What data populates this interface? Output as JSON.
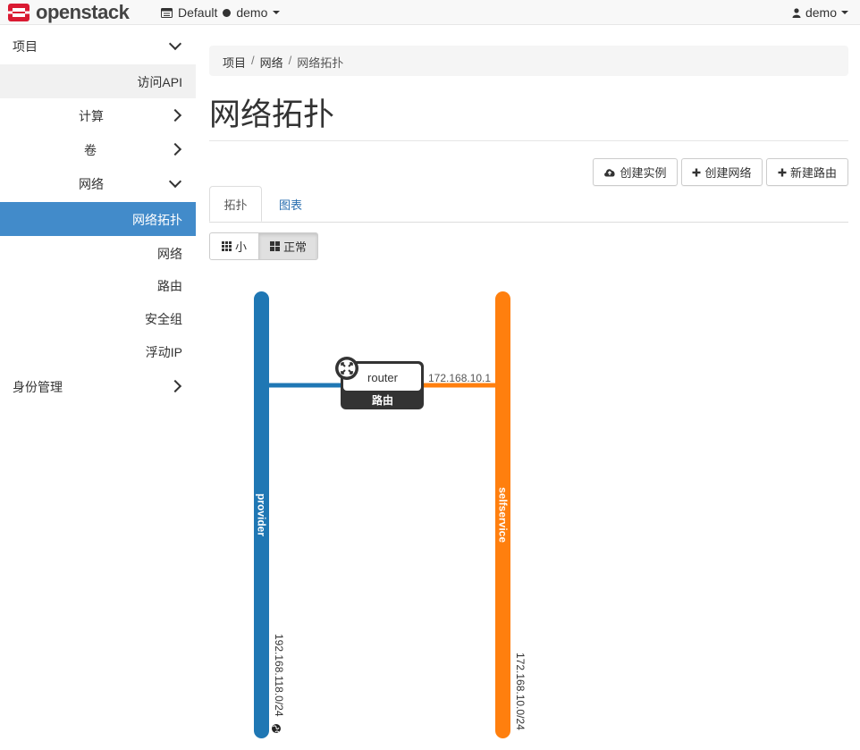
{
  "navbar": {
    "brand": "openstack",
    "domain": "Default",
    "project": "demo",
    "user": "demo"
  },
  "sidebar": {
    "project": "项目",
    "api_access": "访问API",
    "compute": "计算",
    "volumes": "卷",
    "network": "网络",
    "network_topology": "网络拓扑",
    "networks": "网络",
    "routers": "路由",
    "security_groups": "安全组",
    "floating_ips": "浮动IP",
    "identity": "身份管理"
  },
  "breadcrumb": [
    "项目",
    "网络",
    "网络拓扑"
  ],
  "page_title": "网络拓扑",
  "actions": {
    "launch_instance": "创建实例",
    "create_network": "创建网络",
    "create_router": "新建路由"
  },
  "tabs": {
    "topology": "拓扑",
    "graph": "图表"
  },
  "size_toggle": {
    "small": "小",
    "normal": "正常"
  },
  "topology": {
    "networks": [
      {
        "name": "provider",
        "cidr": "192.168.118.0/24",
        "color": "#1f77b4",
        "external": true
      },
      {
        "name": "selfservice",
        "cidr": "172.168.10.0/24",
        "color": "#ff7f0e",
        "external": false
      }
    ],
    "router": {
      "name": "router",
      "label": "路由",
      "interface_ip": "172.168.10.1"
    }
  },
  "colors": {
    "active_nav": "#428bca",
    "link": "#2a6fb0",
    "brand_red": "#da1a32"
  }
}
